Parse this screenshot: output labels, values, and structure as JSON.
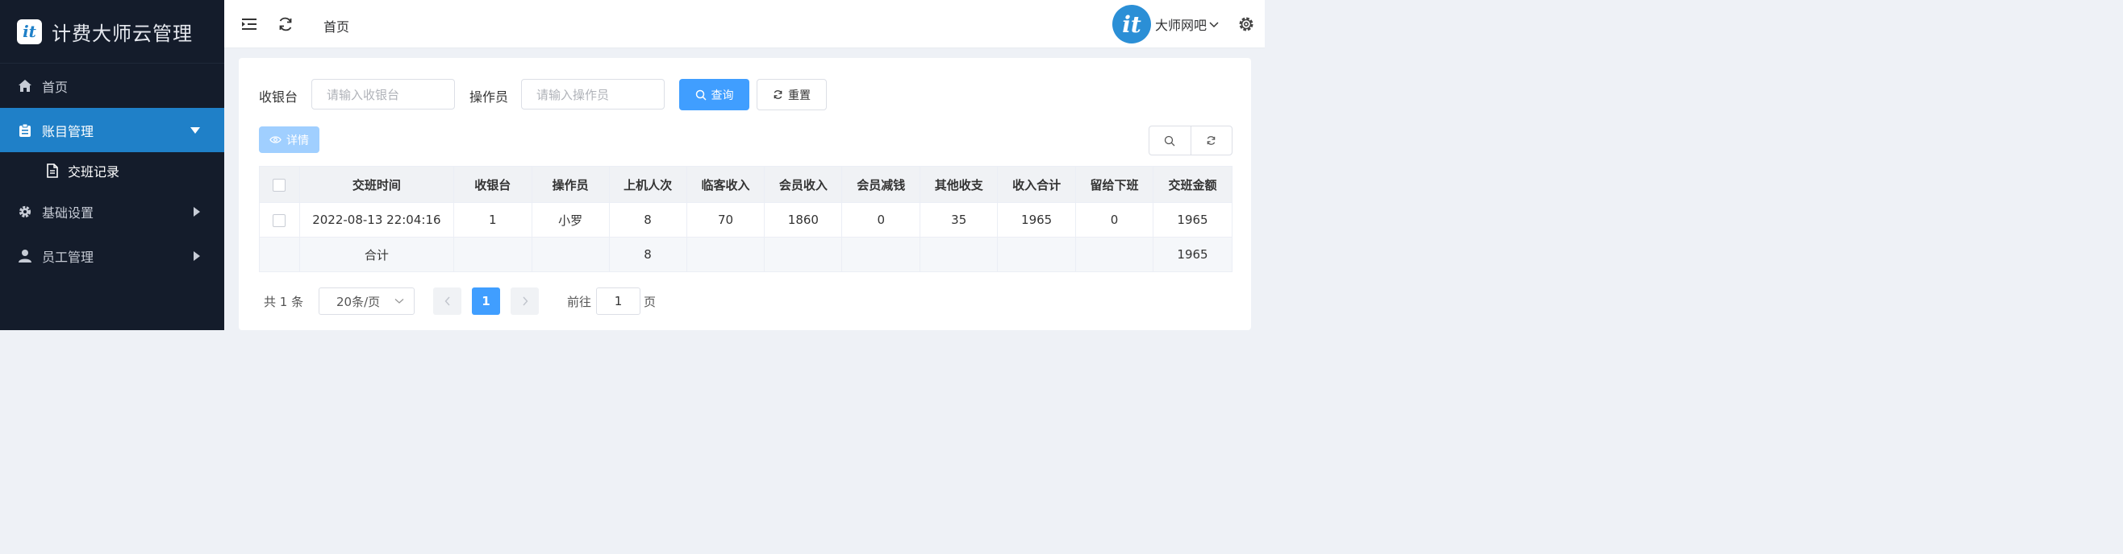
{
  "brand": {
    "title": "计费大师云管理",
    "logo_text": "it"
  },
  "sidebar": {
    "items": [
      {
        "label": "首页",
        "icon": "home-icon"
      },
      {
        "label": "账目管理",
        "icon": "clipboard-icon"
      },
      {
        "label": "交班记录",
        "icon": "document-icon"
      },
      {
        "label": "基础设置",
        "icon": "gear-icon"
      },
      {
        "label": "员工管理",
        "icon": "user-icon"
      }
    ]
  },
  "header": {
    "breadcrumb": "首页",
    "user_name": "大师网吧",
    "avatar_text": "it"
  },
  "search": {
    "cashier_label": "收银台",
    "cashier_placeholder": "请输入收银台",
    "operator_label": "操作员",
    "operator_placeholder": "请输入操作员",
    "query_label": "查询",
    "reset_label": "重置",
    "detail_label": "详情"
  },
  "table": {
    "columns": [
      "交班时间",
      "收银台",
      "操作员",
      "上机人次",
      "临客收入",
      "会员收入",
      "会员减钱",
      "其他收支",
      "收入合计",
      "留给下班",
      "交班金额"
    ],
    "rows": [
      [
        "2022-08-13 22:04:16",
        "1",
        "小罗",
        "8",
        "70",
        "1860",
        "0",
        "35",
        "1965",
        "0",
        "1965"
      ]
    ],
    "summary": {
      "label": "合计",
      "shift_count": "8",
      "handover_amount": "1965"
    }
  },
  "pagination": {
    "total": "共 1 条",
    "page_size": "20条/页",
    "current_page": "1",
    "goto_label": "前往",
    "goto_value": "1",
    "page_unit": "页"
  },
  "colors": {
    "sidebar_bg": "#141c2b",
    "active_menu": "#1f80c8",
    "primary": "#409eff"
  }
}
